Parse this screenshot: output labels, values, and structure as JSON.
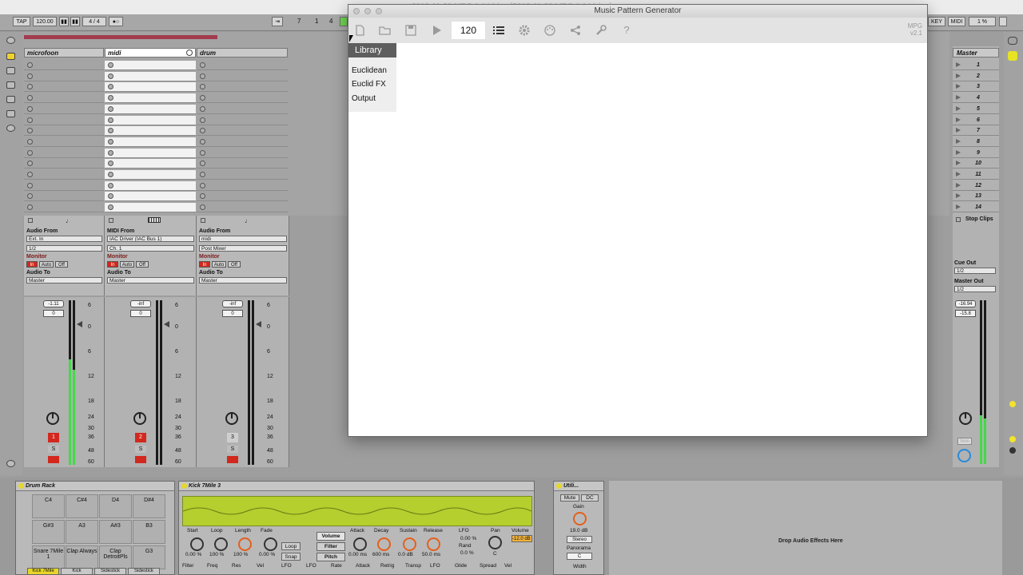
{
  "mac_title": "2019-11-20 MPG 1.1 Video [2019-11-20 MPG 1.1 Video]",
  "live_top": {
    "tap": "TAP",
    "tempo": "120.00",
    "time_sig": "4 / 4",
    "pos_bar": "7",
    "pos_beat": "1",
    "pos_sixteenth": "4",
    "key_label": "KEY",
    "midi_label": "MIDI",
    "cpu": "1 %"
  },
  "tracks": [
    {
      "name": "microfoon",
      "type": "audio",
      "from_label": "Audio From",
      "from_value": "Ext. In",
      "channel": "1/2",
      "monitor_label": "Monitor",
      "monitor": [
        "In",
        "Auto",
        "Off"
      ],
      "to_label": "Audio To",
      "to_value": "Master",
      "volume": "-1.11",
      "pan": "0",
      "number": "1",
      "solo": "S"
    },
    {
      "name": "midi",
      "type": "midi",
      "from_label": "MIDI From",
      "from_value": "IAC Driver (IAC Bus 1)",
      "channel": "Ch. 1",
      "monitor_label": "Monitor",
      "monitor": [
        "In",
        "Auto",
        "Off"
      ],
      "to_label": "Audio To",
      "to_value": "Master",
      "volume": "-inf",
      "pan": "0",
      "number": "2",
      "solo": "S"
    },
    {
      "name": "drum",
      "type": "audio",
      "from_label": "Audio From",
      "from_value": "midi",
      "channel": "Post Mixer",
      "monitor_label": "Monitor",
      "monitor": [
        "In",
        "Auto",
        "Off"
      ],
      "to_label": "Audio To",
      "to_value": "Master",
      "volume": "-inf",
      "pan": "0",
      "number": "3",
      "solo": "S"
    }
  ],
  "meter_scale": [
    "6",
    "0",
    "6",
    "12",
    "18",
    "24",
    "30",
    "36",
    "48",
    "60"
  ],
  "master": {
    "name": "Master",
    "scenes": [
      "1",
      "2",
      "3",
      "4",
      "5",
      "6",
      "7",
      "8",
      "9",
      "10",
      "11",
      "12",
      "13",
      "14"
    ],
    "stop_clips": "Stop Clips",
    "cue_out_label": "Cue Out",
    "cue_out_value": "1/2",
    "master_out_label": "Master Out",
    "master_out_value": "1/2",
    "level_a": "-16.94",
    "level_b": "-15.8",
    "solo": "Solo"
  },
  "mpg": {
    "title": "Music Pattern Generator",
    "bpm": "120",
    "version_line1": "MPG",
    "version_line2": "v2.1",
    "library_title": "Library",
    "library_items": [
      "Euclidean",
      "Euclid FX",
      "Output"
    ]
  },
  "devices": {
    "drum_rack": {
      "title": "Drum Rack",
      "pads": [
        "C4",
        "C#4",
        "D4",
        "D#4",
        "G#3",
        "A3",
        "A#3",
        "B3",
        "Snare 7Mile 1",
        "Clap Always",
        "Clap DetroitPls",
        "G3"
      ],
      "bottom": [
        "Kick 7Mile",
        "Kick",
        "Sidestick",
        "Sidestick"
      ]
    },
    "simpler": {
      "title": "Kick 7Mile 3",
      "params": [
        "Start",
        "Loop",
        "Length",
        "Fade"
      ],
      "values": [
        "0.00 %",
        "100 %",
        "100 %",
        "0.00 %"
      ],
      "loop": "Loop",
      "snap": "Snap",
      "tabs": [
        "Volume",
        "Filter",
        "Pitch"
      ],
      "env": [
        "Attack",
        "Decay",
        "Sustain",
        "Release"
      ],
      "env_values": [
        "0.00 ms",
        "600 ms",
        "0.0 dB",
        "50.0 ms"
      ],
      "lfo": "LFO",
      "rand": "Rand",
      "pan": "Pan",
      "volume": "Volume",
      "volume_value": "-12.0 dB",
      "pan_value": "C",
      "lfo_value": "0.00 %",
      "rand_value": "0.0 %",
      "bottom": [
        "Filter",
        "Freq",
        "Res",
        "Vel",
        "LFO",
        "LFO",
        "Rate",
        "Attack",
        "Retrig",
        "Transp",
        "LFO",
        "Glide",
        "Spread",
        "Vel"
      ]
    },
    "utility": {
      "title": "Utili...",
      "mute": "Mute",
      "dc": "DC",
      "gain": "Gain",
      "gain_value": "19.0 dB",
      "stereo": "Stereo",
      "panorama": "Panorama",
      "pan_value": "C",
      "width": "Width"
    },
    "drop_hint": "Drop Audio Effects Here"
  }
}
